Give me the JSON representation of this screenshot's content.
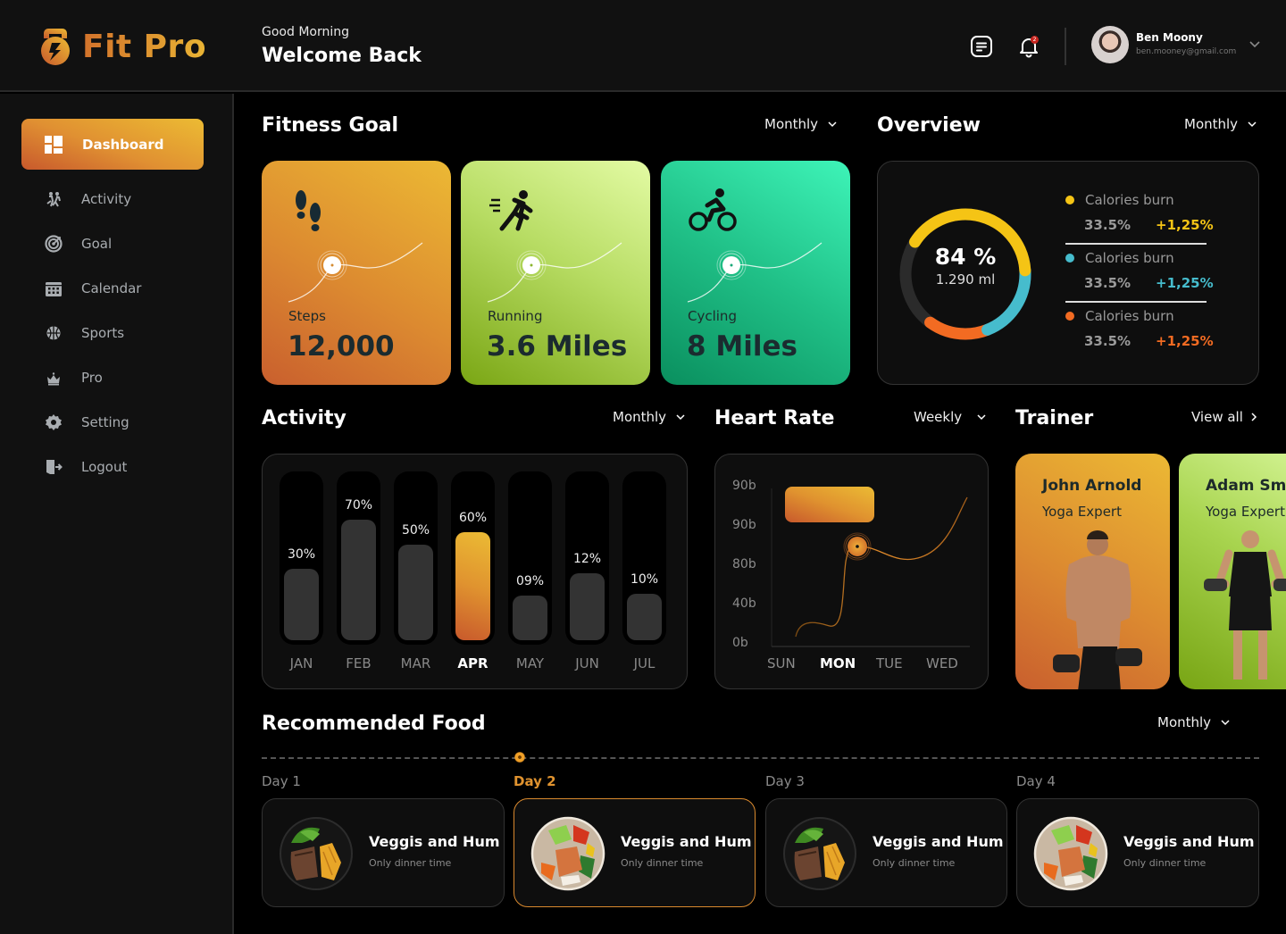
{
  "app": {
    "name": "Fit Pro",
    "brand_gradient": [
      "#c8592c",
      "#ecbb33"
    ]
  },
  "header": {
    "greeting": "Good Morning",
    "welcome": "Welcome Back",
    "notifications_count": "2",
    "user": {
      "name": "Ben Moony",
      "email": "ben.mooney@gmail.com"
    }
  },
  "sidebar": {
    "items": [
      {
        "label": "Dashboard",
        "icon": "dashboard-icon",
        "active": true
      },
      {
        "label": "Activity",
        "icon": "activity-icon"
      },
      {
        "label": "Goal",
        "icon": "target-icon"
      },
      {
        "label": "Calendar",
        "icon": "calendar-icon"
      },
      {
        "label": "Sports",
        "icon": "basketball-icon"
      },
      {
        "label": "Pro",
        "icon": "crown-icon"
      },
      {
        "label": "Setting",
        "icon": "gear-icon"
      },
      {
        "label": "Logout",
        "icon": "logout-icon"
      }
    ]
  },
  "fitness_goal": {
    "title": "Fitness Goal",
    "period": "Monthly",
    "cards": [
      {
        "label": "Steps",
        "value": "12,000",
        "icon": "footsteps-icon"
      },
      {
        "label": "Running",
        "value": "3.6 Miles",
        "icon": "running-icon"
      },
      {
        "label": "Cycling",
        "value": "8 Miles",
        "icon": "cycling-icon"
      }
    ]
  },
  "overview": {
    "title": "Overview",
    "period": "Monthly",
    "center_value": "84 %",
    "center_sub": "1.290 ml",
    "segments": [
      {
        "label": "Calories burn",
        "value": "33.5%",
        "change": "+1,25%",
        "color": "#f5c415",
        "share": 0.4
      },
      {
        "label": "Calories burn",
        "value": "33.5%",
        "change": "+1,25%",
        "color": "#46bccd",
        "share": 0.2
      },
      {
        "label": "Calories burn",
        "value": "33.5%",
        "change": "+1,25%",
        "color": "#f26b22",
        "share": 0.16
      }
    ]
  },
  "activity": {
    "title": "Activity",
    "period": "Monthly"
  },
  "heart_rate": {
    "title": "Heart Rate",
    "period": "Weekly",
    "y_labels": [
      "90b",
      "90b",
      "80b",
      "40b",
      "0b"
    ],
    "x_labels": [
      "SUN",
      "MON",
      "TUE",
      "WED"
    ],
    "highlight_day": "MON"
  },
  "trainer": {
    "title": "Trainer",
    "view_all": "View all",
    "items": [
      {
        "name": "John Arnold",
        "role": "Yoga Expert"
      },
      {
        "name": "Adam Smith",
        "role": "Yoga Expert"
      }
    ]
  },
  "food": {
    "title": "Recommended Food",
    "period": "Monthly",
    "items": [
      {
        "day": "Day 1",
        "title": "Veggis and Hum",
        "subtitle": "Only dinner time",
        "dish": "steak-plate"
      },
      {
        "day": "Day 2",
        "title": "Veggis and Hum",
        "subtitle": "Only dinner time",
        "dish": "poke-bowl",
        "active": true
      },
      {
        "day": "Day 3",
        "title": "Veggis and Hum",
        "subtitle": "Only dinner time",
        "dish": "steak-plate"
      },
      {
        "day": "Day 4",
        "title": "Veggis and Hum",
        "subtitle": "Only dinner time",
        "dish": "poke-bowl"
      }
    ]
  },
  "chart_data": [
    {
      "type": "bar",
      "title": "Activity",
      "categories": [
        "JAN",
        "FEB",
        "MAR",
        "APR",
        "MAY",
        "JUN",
        "JUL"
      ],
      "values": [
        30,
        70,
        50,
        60,
        9,
        12,
        10
      ],
      "value_labels": [
        "30%",
        "70%",
        "50%",
        "60%",
        "09%",
        "12%",
        "10%"
      ],
      "highlight": "APR",
      "ylim": [
        0,
        100
      ]
    },
    {
      "type": "line",
      "title": "Heart Rate",
      "x": [
        "SUN",
        "MON",
        "TUE",
        "WED"
      ],
      "y_tick_labels": [
        "0b",
        "40b",
        "80b",
        "90b",
        "90b"
      ],
      "highlight_point": "MON"
    }
  ]
}
